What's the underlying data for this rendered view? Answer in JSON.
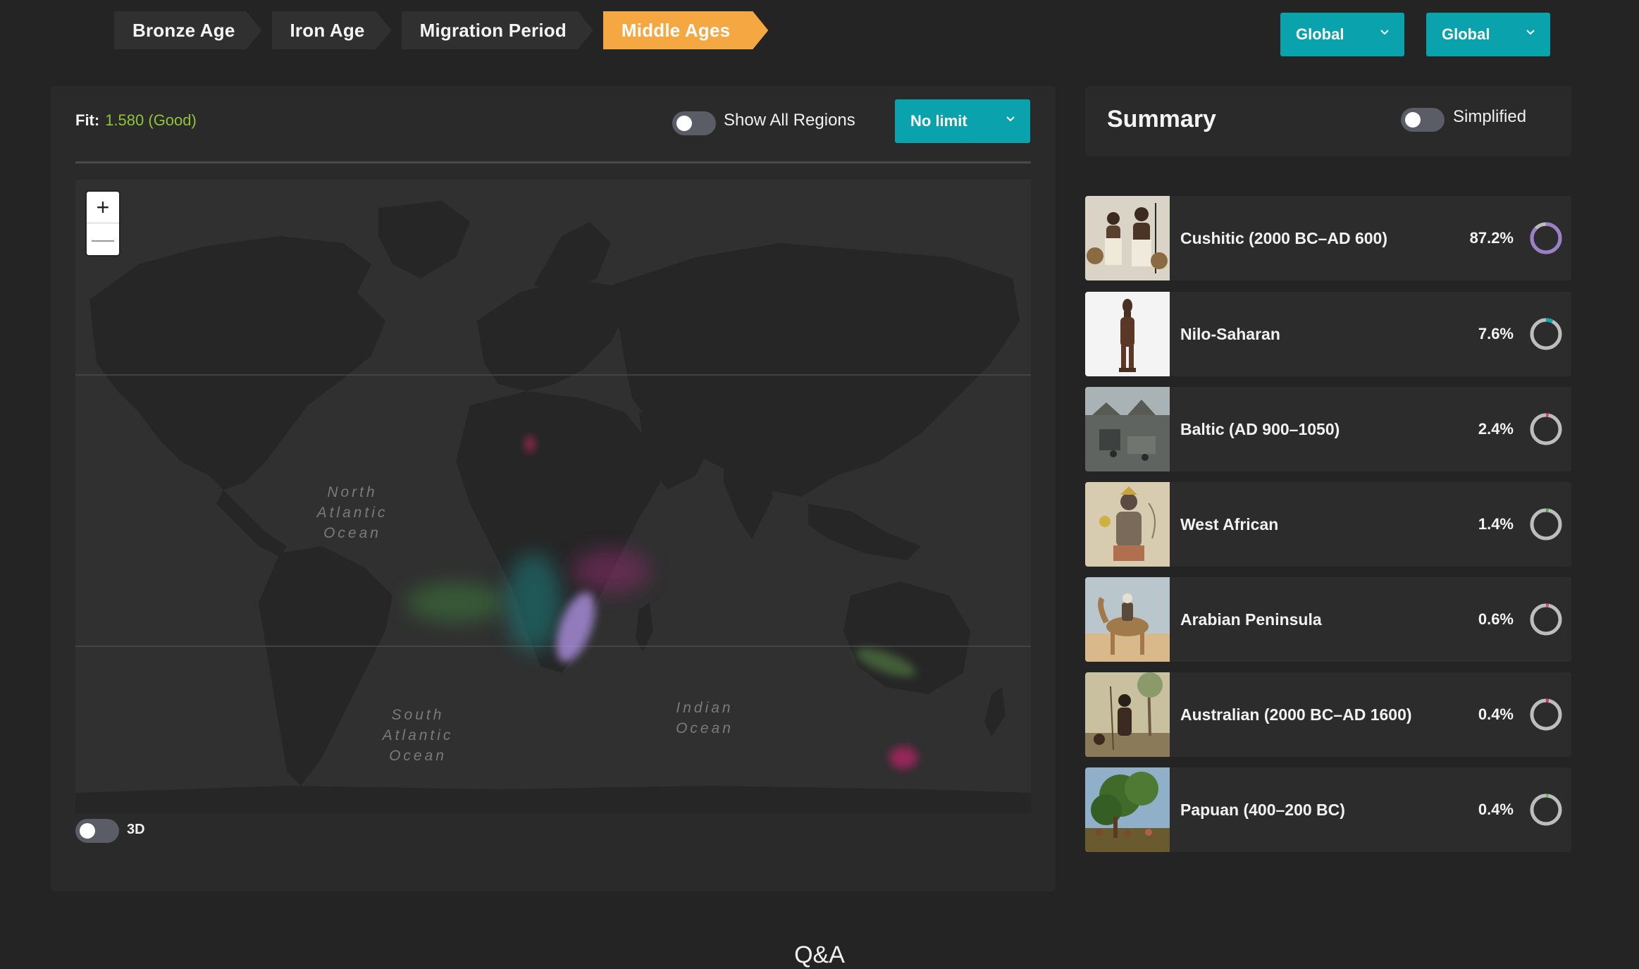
{
  "eras": [
    {
      "label": "Bronze Age",
      "active": false
    },
    {
      "label": "Iron Age",
      "active": false
    },
    {
      "label": "Migration Period",
      "active": false
    },
    {
      "label": "Middle Ages",
      "active": true
    }
  ],
  "filters": {
    "region_1": "Global",
    "region_2": "Global"
  },
  "map_panel": {
    "fit_label": "Fit:",
    "fit_value": "1.580 (Good)",
    "show_all_regions_label": "Show All Regions",
    "limit_select": "No limit",
    "zoom_in": "+",
    "zoom_out": "—",
    "toggle_3d_label": "3D",
    "oceans": {
      "north_atlantic": [
        "North",
        "Atlantic",
        "Ocean"
      ],
      "south_atlantic": [
        "South",
        "Atlantic",
        "Ocean"
      ],
      "indian": [
        "Indian",
        "Ocean"
      ]
    }
  },
  "summary": {
    "title": "Summary",
    "simplified_label": "Simplified",
    "items": [
      {
        "name": "Cushitic (2000 BC–AD 600)",
        "percent": "87.2%",
        "fraction": 0.872,
        "color": "#9b7fc7"
      },
      {
        "name": "Nilo-Saharan",
        "percent": "7.6%",
        "fraction": 0.076,
        "color": "#14a7a7"
      },
      {
        "name": "Baltic (AD 900–1050)",
        "percent": "2.4%",
        "fraction": 0.024,
        "color": "#e0407a"
      },
      {
        "name": "West African",
        "percent": "1.4%",
        "fraction": 0.014,
        "color": "#4caf50"
      },
      {
        "name": "Arabian Peninsula",
        "percent": "0.6%",
        "fraction": 0.006,
        "color": "#d04a8c"
      },
      {
        "name": "Australian (2000 BC–AD 1600)",
        "percent": "0.4%",
        "fraction": 0.004,
        "color": "#e0305a"
      },
      {
        "name": "Papuan (400–200 BC)",
        "percent": "0.4%",
        "fraction": 0.004,
        "color": "#7fb35a"
      }
    ]
  },
  "footer": {
    "qa_heading": "Q&A"
  }
}
